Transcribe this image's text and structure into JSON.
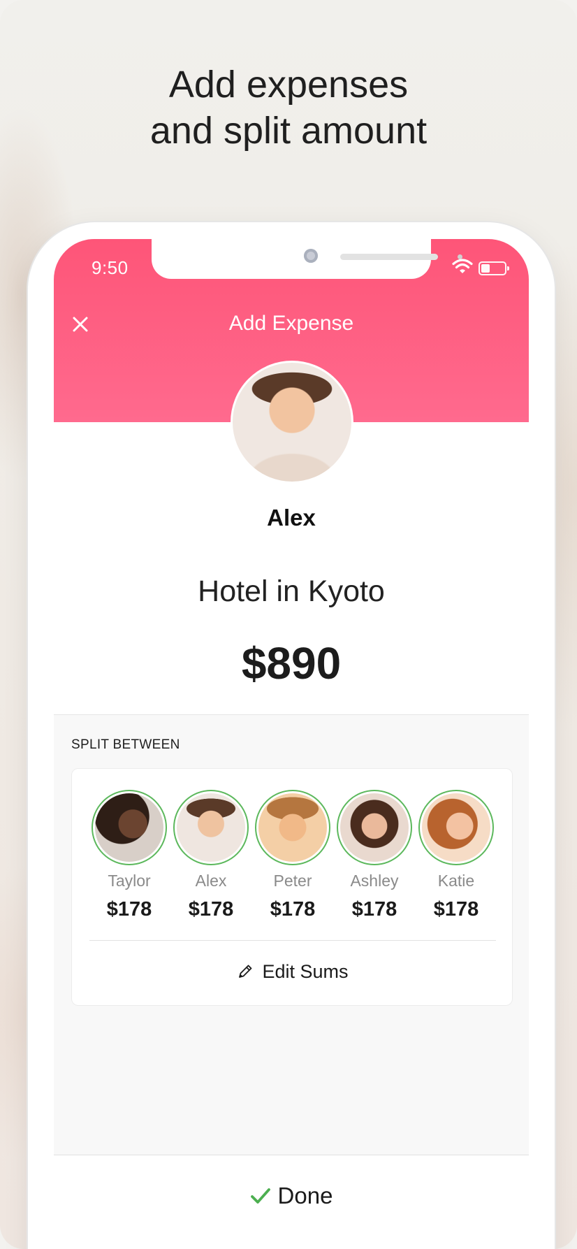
{
  "promo": {
    "headline_line1": "Add expenses",
    "headline_line2": "and split amount"
  },
  "status_bar": {
    "time": "9:50",
    "icons": [
      "wifi-icon",
      "battery-icon"
    ]
  },
  "header": {
    "close_icon": "close-icon",
    "title": "Add Expense",
    "color_top": "#fe5578",
    "color_bottom": "#ff6a8e"
  },
  "expense": {
    "payer_name": "Alex",
    "title": "Hotel in Kyoto",
    "amount": "$890"
  },
  "split": {
    "section_label": "SPLIT BETWEEN",
    "selected_ring_color": "#5cb85c",
    "members": [
      {
        "name": "Taylor",
        "amount": "$178"
      },
      {
        "name": "Alex",
        "amount": "$178"
      },
      {
        "name": "Peter",
        "amount": "$178"
      },
      {
        "name": "Ashley",
        "amount": "$178"
      },
      {
        "name": "Katie",
        "amount": "$178"
      }
    ],
    "edit_label": "Edit Sums",
    "edit_icon": "pencil-icon"
  },
  "footer": {
    "done_label": "Done",
    "done_icon": "check-icon",
    "check_color": "#4caf50"
  }
}
